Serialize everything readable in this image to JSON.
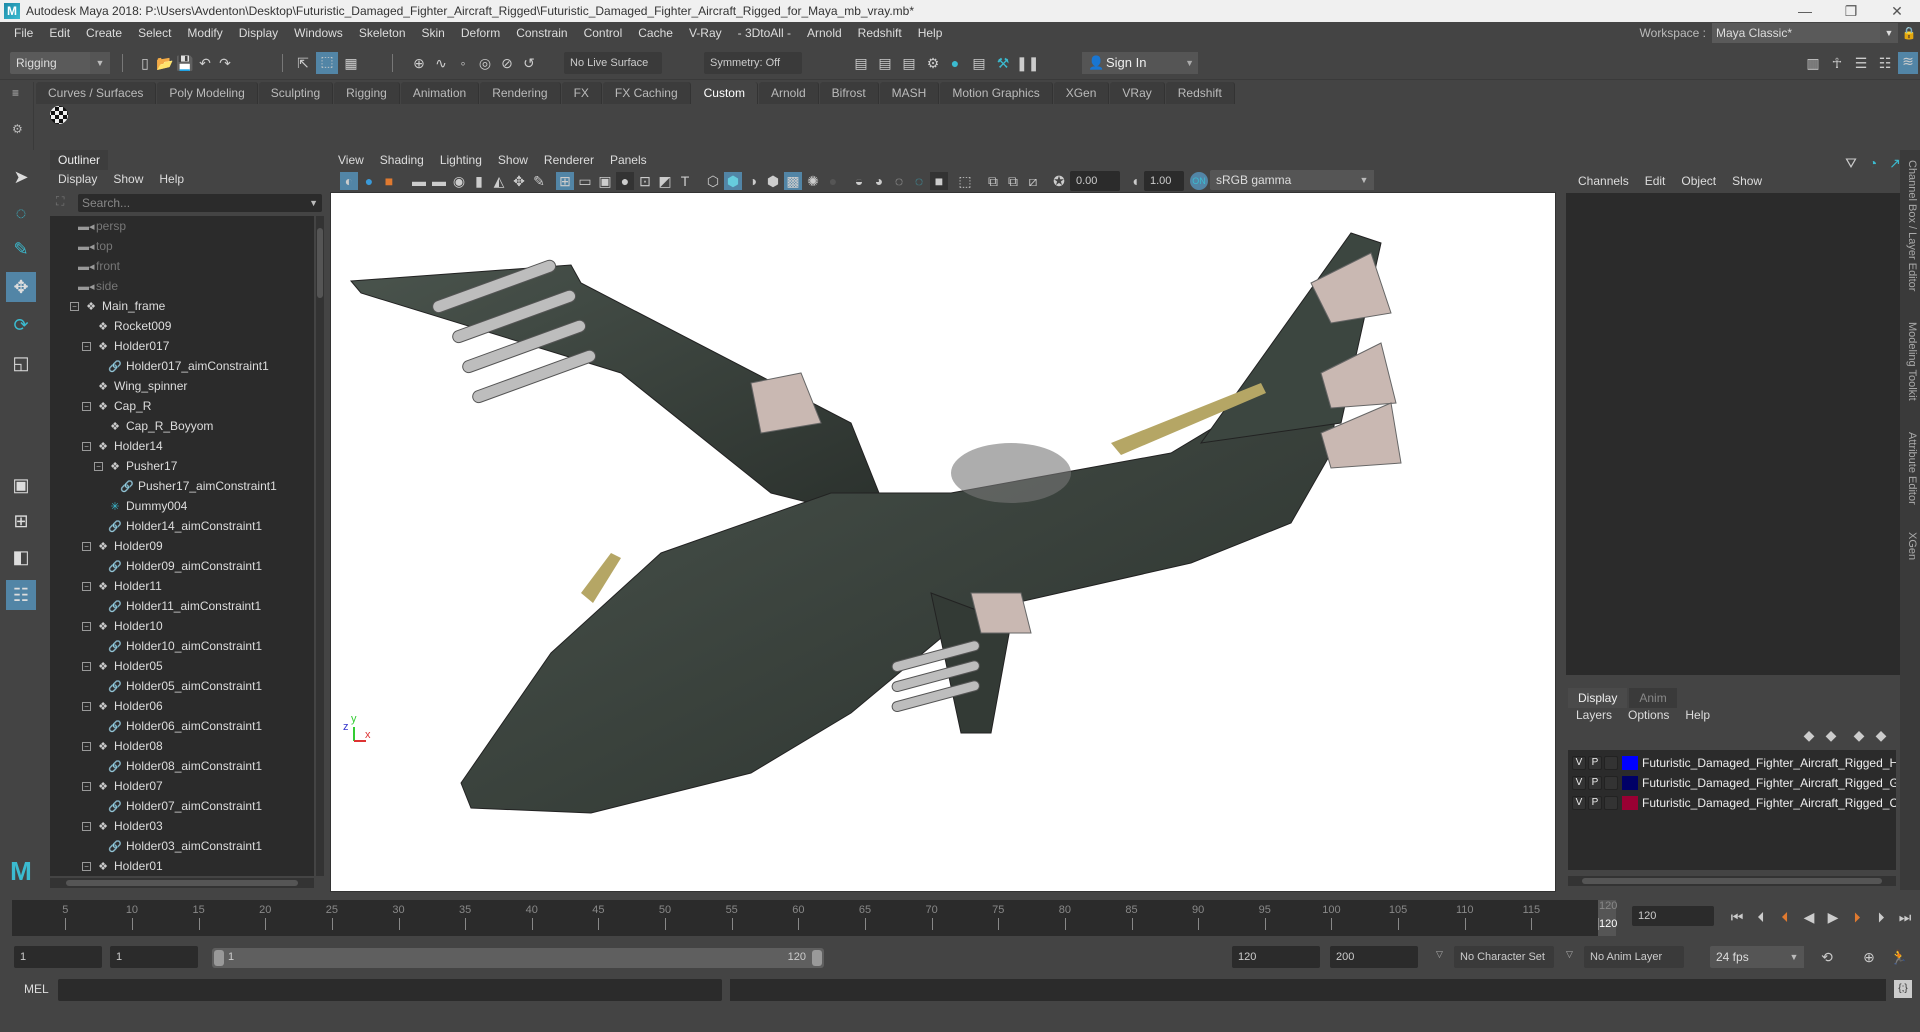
{
  "window": {
    "title": "Autodesk Maya 2018: P:\\Users\\Avdenton\\Desktop\\Futuristic_Damaged_Fighter_Aircraft_Rigged\\Futuristic_Damaged_Fighter_Aircraft_Rigged_for_Maya_mb_vray.mb*",
    "app_icon": "M"
  },
  "menubar": {
    "items": [
      "File",
      "Edit",
      "Create",
      "Select",
      "Modify",
      "Display",
      "Windows",
      "Skeleton",
      "Skin",
      "Deform",
      "Constrain",
      "Control",
      "Cache",
      "V-Ray",
      "- 3DtoAll -",
      "Arnold",
      "Redshift",
      "Help"
    ],
    "workspace_label": "Workspace :",
    "workspace_value": "Maya Classic*"
  },
  "statusline": {
    "menuset": "Rigging",
    "live_surface": "No Live Surface",
    "symmetry": "Symmetry: Off",
    "sign_in": "Sign In"
  },
  "shelf": {
    "tabs": [
      "Curves / Surfaces",
      "Poly Modeling",
      "Sculpting",
      "Rigging",
      "Animation",
      "Rendering",
      "FX",
      "FX Caching",
      "Custom",
      "Arnold",
      "Bifrost",
      "MASH",
      "Motion Graphics",
      "XGen",
      "VRay",
      "Redshift"
    ],
    "active_tab": "Custom"
  },
  "outliner": {
    "tab": "Outliner",
    "menu": [
      "Display",
      "Show",
      "Help"
    ],
    "search_placeholder": "Search...",
    "items": [
      {
        "label": "persp",
        "type": "camera",
        "depth": 0
      },
      {
        "label": "top",
        "type": "camera",
        "depth": 0
      },
      {
        "label": "front",
        "type": "camera",
        "depth": 0
      },
      {
        "label": "side",
        "type": "camera",
        "depth": 0
      },
      {
        "label": "Main_frame",
        "type": "transform",
        "depth": 0,
        "expanded": true
      },
      {
        "label": "Rocket009",
        "type": "transform",
        "depth": 1
      },
      {
        "label": "Holder017",
        "type": "transform",
        "depth": 1,
        "expanded": true
      },
      {
        "label": "Holder017_aimConstraint1",
        "type": "constraint",
        "depth": 2
      },
      {
        "label": "Wing_spinner",
        "type": "transform",
        "depth": 1
      },
      {
        "label": "Cap_R",
        "type": "transform",
        "depth": 1,
        "expanded": true
      },
      {
        "label": "Cap_R_Boyyom",
        "type": "transform",
        "depth": 2
      },
      {
        "label": "Holder14",
        "type": "transform",
        "depth": 1,
        "expanded": true
      },
      {
        "label": "Pusher17",
        "type": "transform",
        "depth": 2,
        "expanded": true
      },
      {
        "label": "Pusher17_aimConstraint1",
        "type": "constraint",
        "depth": 3
      },
      {
        "label": "Dummy004",
        "type": "locator",
        "depth": 2
      },
      {
        "label": "Holder14_aimConstraint1",
        "type": "constraint",
        "depth": 2
      },
      {
        "label": "Holder09",
        "type": "transform",
        "depth": 1,
        "expanded": true
      },
      {
        "label": "Holder09_aimConstraint1",
        "type": "constraint",
        "depth": 2
      },
      {
        "label": "Holder11",
        "type": "transform",
        "depth": 1,
        "expanded": true
      },
      {
        "label": "Holder11_aimConstraint1",
        "type": "constraint",
        "depth": 2
      },
      {
        "label": "Holder10",
        "type": "transform",
        "depth": 1,
        "expanded": true
      },
      {
        "label": "Holder10_aimConstraint1",
        "type": "constraint",
        "depth": 2
      },
      {
        "label": "Holder05",
        "type": "transform",
        "depth": 1,
        "expanded": true
      },
      {
        "label": "Holder05_aimConstraint1",
        "type": "constraint",
        "depth": 2
      },
      {
        "label": "Holder06",
        "type": "transform",
        "depth": 1,
        "expanded": true
      },
      {
        "label": "Holder06_aimConstraint1",
        "type": "constraint",
        "depth": 2
      },
      {
        "label": "Holder08",
        "type": "transform",
        "depth": 1,
        "expanded": true
      },
      {
        "label": "Holder08_aimConstraint1",
        "type": "constraint",
        "depth": 2
      },
      {
        "label": "Holder07",
        "type": "transform",
        "depth": 1,
        "expanded": true
      },
      {
        "label": "Holder07_aimConstraint1",
        "type": "constraint",
        "depth": 2
      },
      {
        "label": "Holder03",
        "type": "transform",
        "depth": 1,
        "expanded": true
      },
      {
        "label": "Holder03_aimConstraint1",
        "type": "constraint",
        "depth": 2
      },
      {
        "label": "Holder01",
        "type": "transform",
        "depth": 1,
        "expanded": true
      }
    ]
  },
  "viewport": {
    "menu": [
      "View",
      "Shading",
      "Lighting",
      "Show",
      "Renderer",
      "Panels"
    ],
    "exposure": "0.00",
    "gamma": "1.00",
    "color_space": "sRGB gamma",
    "axis_labels": {
      "x": "x",
      "y": "y",
      "z": "z"
    }
  },
  "channelbox": {
    "menu": [
      "Channels",
      "Edit",
      "Object",
      "Show"
    ]
  },
  "side_tabs": [
    "Channel Box / Layer Editor",
    "Modeling Toolkit",
    "Attribute Editor",
    "XGen"
  ],
  "layer_editor": {
    "tabs": [
      "Display",
      "Anim"
    ],
    "active_tab": "Display",
    "menu": [
      "Layers",
      "Options",
      "Help"
    ],
    "layers": [
      {
        "v": "V",
        "p": "P",
        "color": "#0000ff",
        "name": "Futuristic_Damaged_Fighter_Aircraft_Rigged_Hel"
      },
      {
        "v": "V",
        "p": "P",
        "color": "#000066",
        "name": "Futuristic_Damaged_Fighter_Aircraft_Rigged_Geom"
      },
      {
        "v": "V",
        "p": "P",
        "color": "#990033",
        "name": "Futuristic_Damaged_Fighter_Aircraft_Rigged_Contro"
      }
    ]
  },
  "timeline": {
    "tick_labels": [
      "5",
      "10",
      "15",
      "20",
      "25",
      "30",
      "35",
      "40",
      "45",
      "50",
      "55",
      "60",
      "65",
      "70",
      "75",
      "80",
      "85",
      "90",
      "95",
      "100",
      "105",
      "110",
      "115",
      "120"
    ],
    "range_start": 1,
    "range_end": 120,
    "current_frame": "120",
    "current_frame_marker": "120"
  },
  "range": {
    "start_field": "1",
    "playback_start": "1",
    "slider_start": "1",
    "slider_end": "120",
    "playback_end": "120",
    "end_field": "200",
    "character_set": "No Character Set",
    "anim_layer": "No Anim Layer",
    "fps": "24 fps"
  },
  "cmdline": {
    "language": "MEL"
  },
  "colors": {
    "accent": "#5285a6",
    "constraint_icon": "#d04040",
    "locator_icon": "#3bbbd0",
    "playhead": "#e07a30"
  }
}
